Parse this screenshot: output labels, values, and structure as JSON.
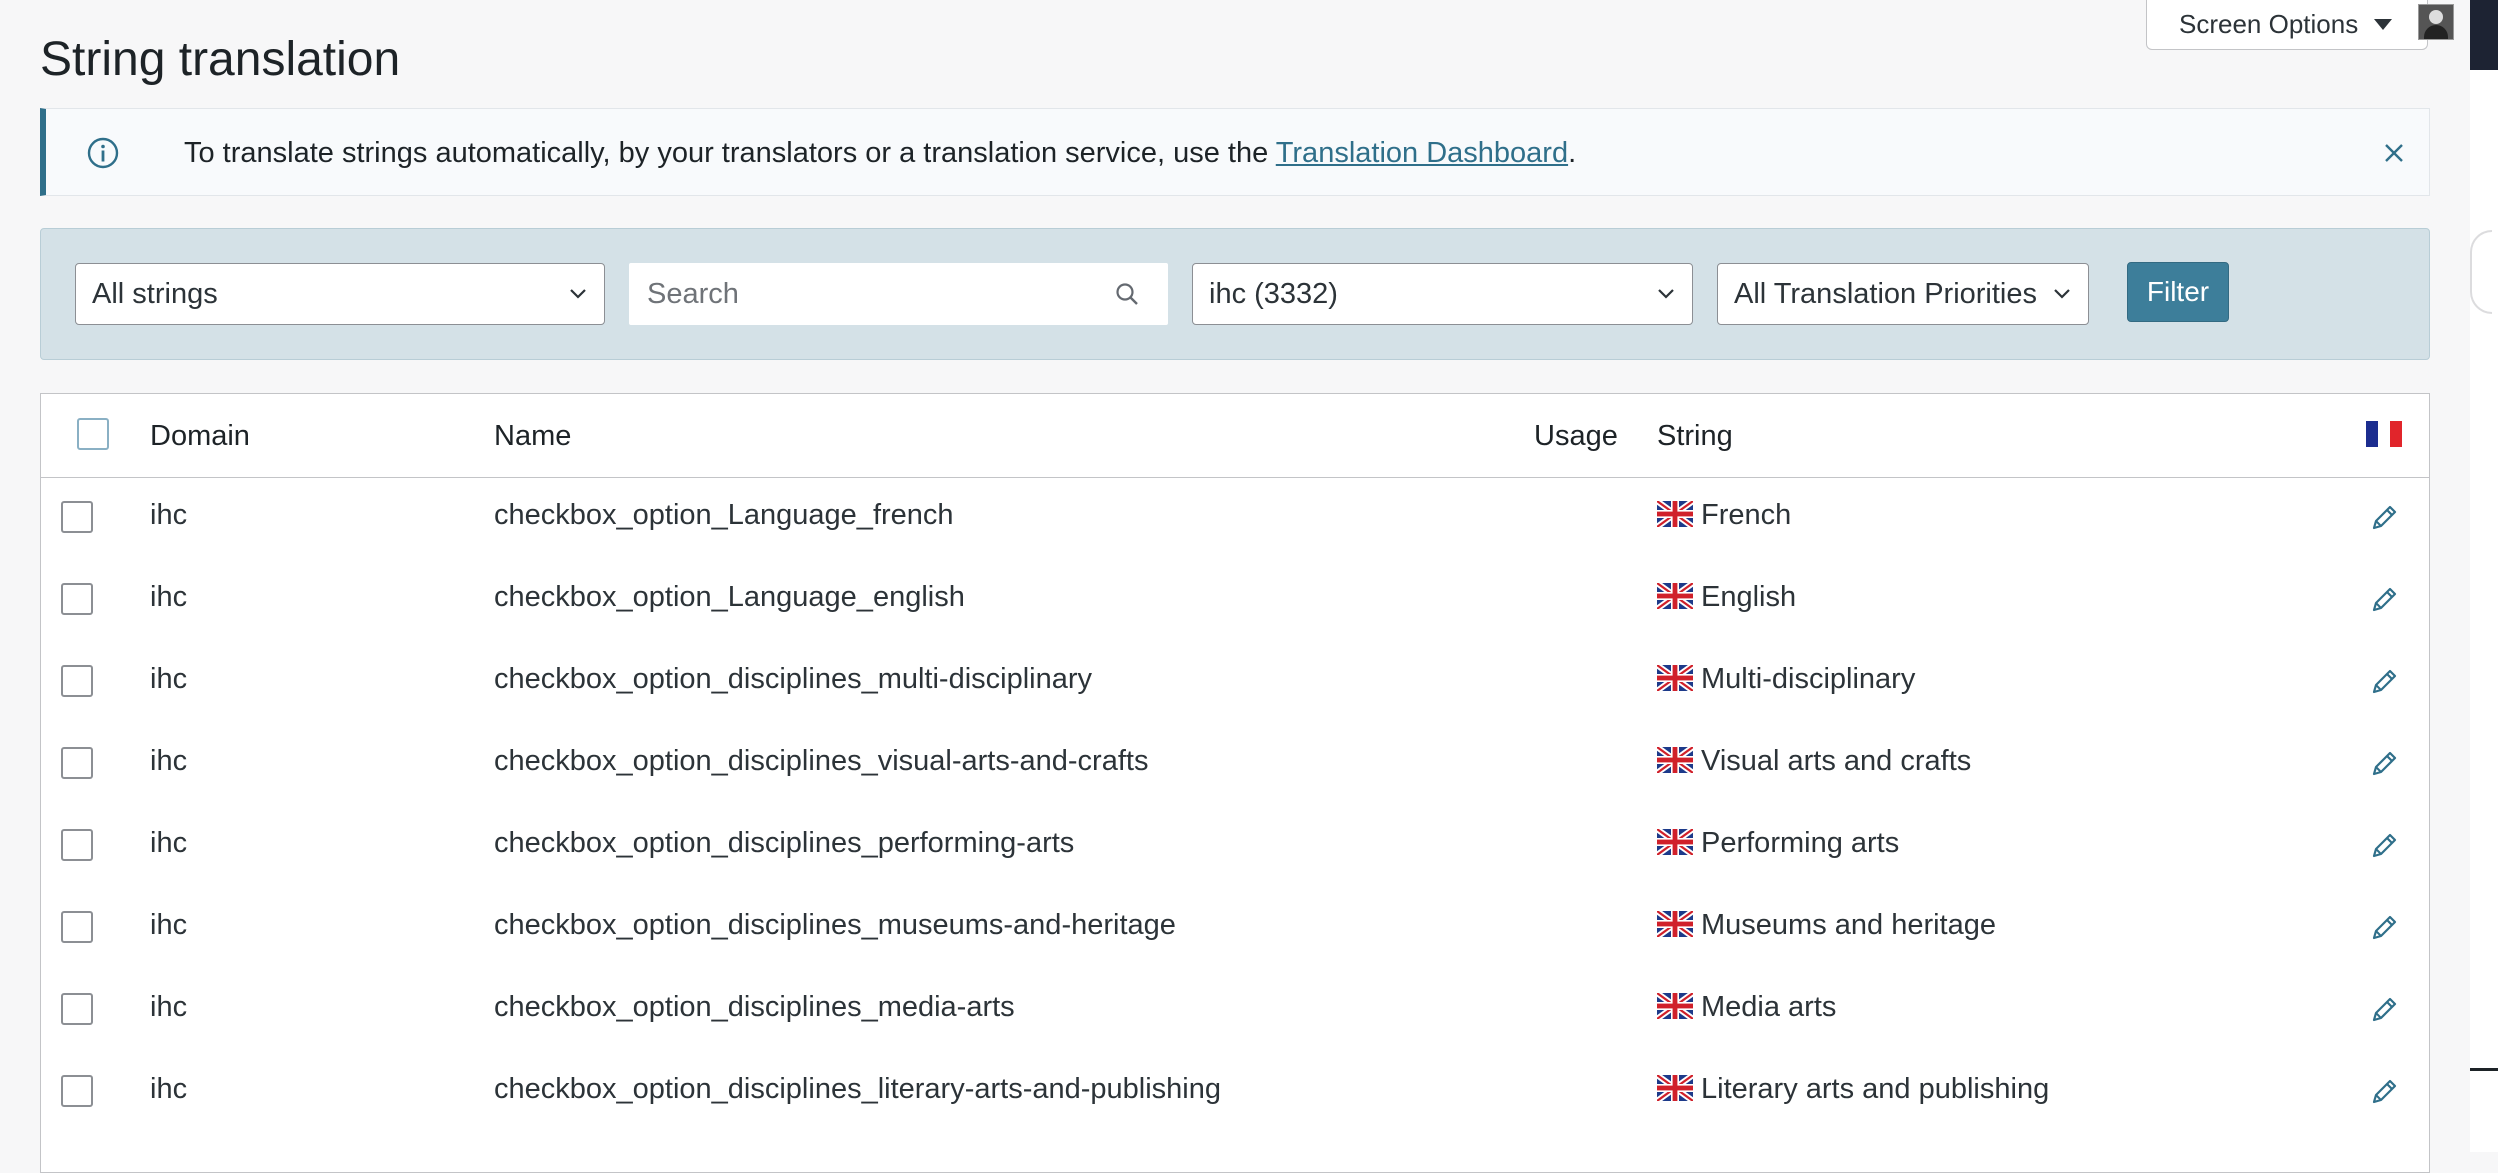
{
  "header": {
    "title": "String translation",
    "screen_options_label": "Screen Options"
  },
  "notice": {
    "message_prefix": "To translate strings automatically, by your translators or a translation service, use the ",
    "link_text": "Translation Dashboard",
    "message_suffix": "."
  },
  "filters": {
    "status_select": "All strings",
    "search_placeholder": "Search",
    "domain_select": "ihc (3332)",
    "priority_select": "All Translation Priorities",
    "filter_button": "Filter"
  },
  "table": {
    "columns": {
      "domain": "Domain",
      "name": "Name",
      "usage": "Usage",
      "string": "String"
    },
    "rows": [
      {
        "domain": "ihc",
        "name": "checkbox_option_Language_french",
        "string": "French"
      },
      {
        "domain": "ihc",
        "name": "checkbox_option_Language_english",
        "string": "English"
      },
      {
        "domain": "ihc",
        "name": "checkbox_option_disciplines_multi-disciplinary",
        "string": "Multi-disciplinary"
      },
      {
        "domain": "ihc",
        "name": "checkbox_option_disciplines_visual-arts-and-crafts",
        "string": "Visual arts and crafts"
      },
      {
        "domain": "ihc",
        "name": "checkbox_option_disciplines_performing-arts",
        "string": "Performing arts"
      },
      {
        "domain": "ihc",
        "name": "checkbox_option_disciplines_museums-and-heritage",
        "string": "Museums and heritage"
      },
      {
        "domain": "ihc",
        "name": "checkbox_option_disciplines_media-arts",
        "string": "Media arts"
      },
      {
        "domain": "ihc",
        "name": "checkbox_option_disciplines_literary-arts-and-publishing",
        "string": "Literary arts and publishing"
      }
    ]
  },
  "icons": {
    "notice": "info-icon",
    "close": "close-icon",
    "dropdown": "chevron-down-icon",
    "search": "search-icon",
    "language_column": "flag-france-icon",
    "source_language": "flag-uk-icon",
    "edit": "pencil-icon"
  },
  "colors": {
    "accent": "#2f6f8a",
    "filter_button": "#3d7e9a",
    "filter_bar_bg": "#d4e1e7"
  }
}
